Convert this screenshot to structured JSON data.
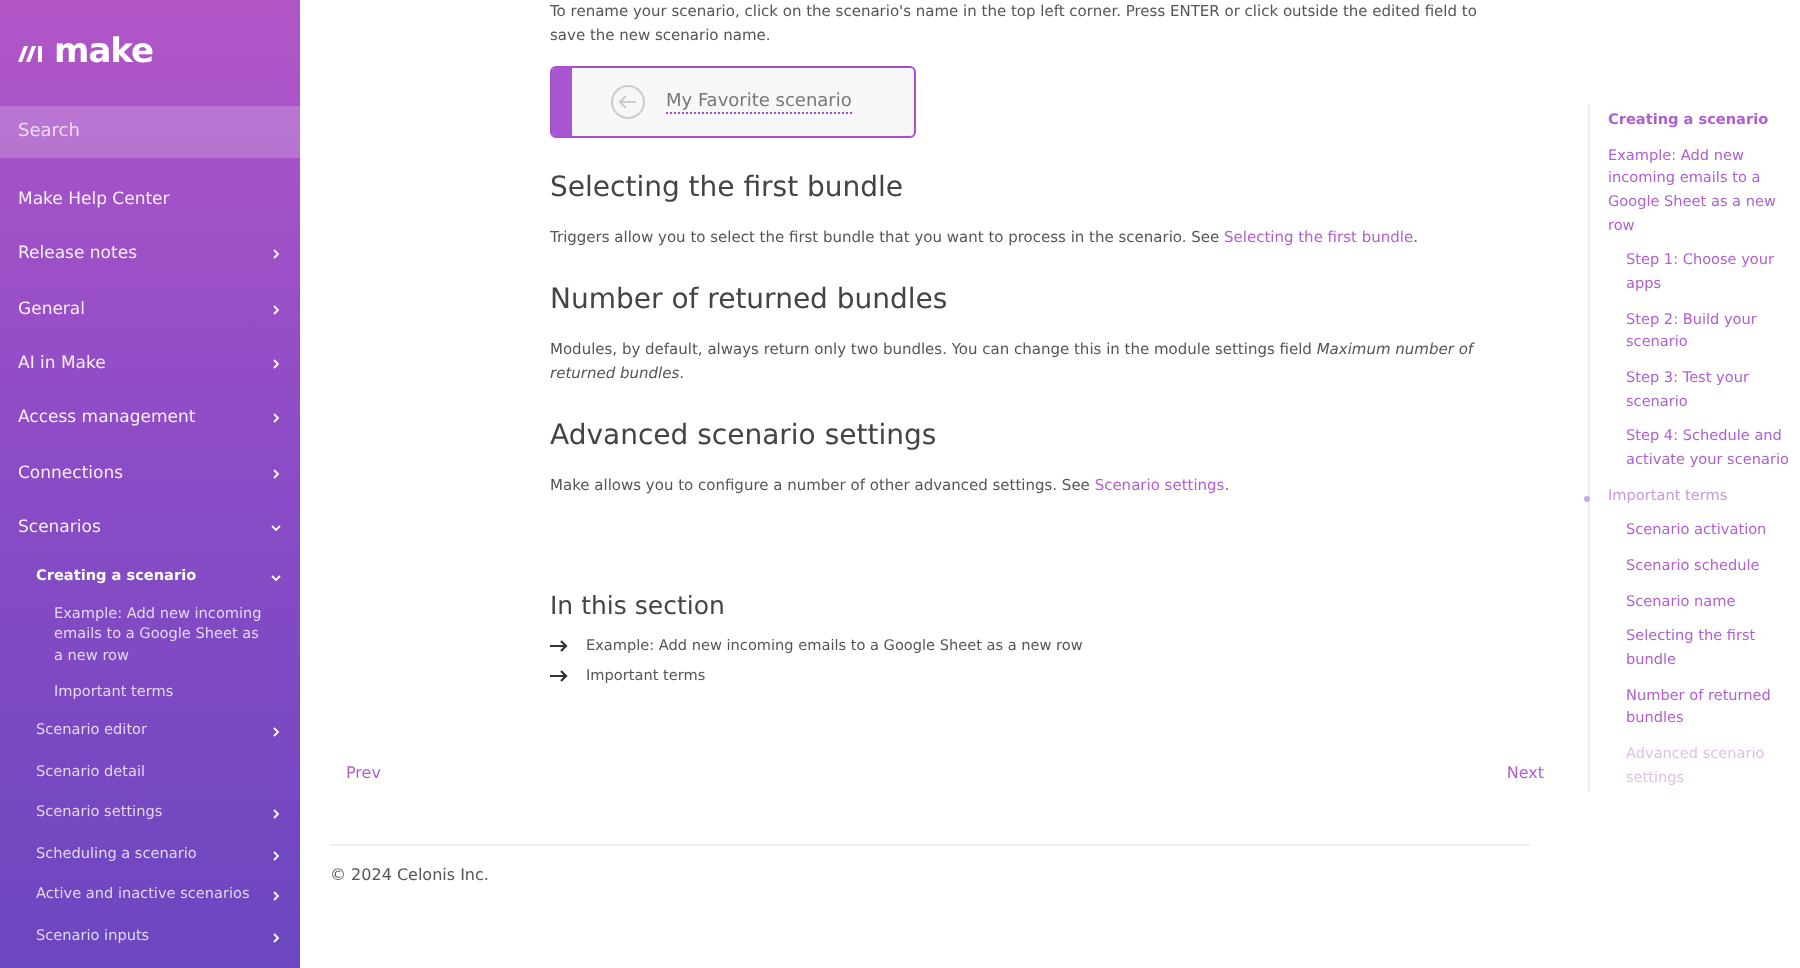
{
  "logo": "make",
  "search": {
    "placeholder": "Search"
  },
  "sidebar": {
    "items": [
      {
        "label": "Make Help Center"
      },
      {
        "label": "Release notes",
        "expanded": false
      },
      {
        "label": "General",
        "expanded": false
      },
      {
        "label": "AI in Make",
        "expanded": false
      },
      {
        "label": "Access management",
        "expanded": false
      },
      {
        "label": "Connections",
        "expanded": false
      },
      {
        "label": "Scenarios",
        "expanded": true,
        "children": [
          {
            "label": "Creating a scenario",
            "expanded": true,
            "selected": true,
            "children": [
              {
                "label": "Example: Add new incoming emails to a Google Sheet as a new row",
                "selected": false
              },
              {
                "label": "Important terms",
                "selected": false
              }
            ]
          },
          {
            "label": "Scenario editor",
            "expanded": false,
            "selected": false
          },
          {
            "label": "Scenario detail",
            "selected": false
          },
          {
            "label": "Scenario settings",
            "expanded": false,
            "selected": false
          },
          {
            "label": "Scheduling a scenario",
            "expanded": false,
            "selected": false
          },
          {
            "label": "Active and inactive scenarios",
            "expanded": false,
            "selected": false
          },
          {
            "label": "Scenario inputs",
            "expanded": false,
            "selected": false
          }
        ]
      }
    ]
  },
  "content": {
    "intro": "To rename your scenario, click on the scenario's name in the top left corner. Press ENTER or click outside the edited field to save the new scenario name.",
    "example_field": {
      "value": "My Favorite scenario"
    },
    "sections": [
      {
        "heading": "Selecting the first bundle",
        "text": "Triggers allow you to select the first bundle that you want to process in the scenario. See ",
        "link": "Selecting the first bundle",
        "after": "."
      },
      {
        "heading": "Number of returned bundles",
        "text": "Modules, by default, always return only two bundles. You can change this in the module settings field *Maximum number of returned bundles*."
      },
      {
        "heading": "Advanced scenario settings",
        "text": "Make allows you to configure a number of other advanced settings. See ",
        "link": "Scenario settings",
        "after": "."
      }
    ],
    "in_this_section": {
      "title": "In this section",
      "links": [
        "Example: Add new incoming emails to a Google Sheet as a new row",
        "Important terms"
      ]
    },
    "prev": "Prev",
    "next": "Next",
    "footer": "© 2024 Celonis Inc."
  },
  "toc": {
    "items": [
      {
        "label": "Creating a scenario",
        "selected": false,
        "faded": false,
        "children": [
          {
            "label": "Example: Add new incoming emails to a Google Sheet as a new row",
            "selected": false,
            "faded": false,
            "children": [
              {
                "label": "Step 1: Choose your apps",
                "selected": false,
                "faded": false
              },
              {
                "label": "Step 2: Build your scenario",
                "selected": false,
                "faded": false
              },
              {
                "label": "Step 3: Test your scenario",
                "selected": false,
                "faded": false
              },
              {
                "label": "Step 4: Schedule and activate your scenario",
                "selected": false,
                "faded": false
              }
            ]
          },
          {
            "label": "Important terms",
            "selected": true,
            "faded": false,
            "children": [
              {
                "label": "Scenario activation",
                "selected": false,
                "faded": false
              },
              {
                "label": "Scenario schedule",
                "selected": false,
                "faded": false
              },
              {
                "label": "Scenario name",
                "selected": false,
                "faded": false
              },
              {
                "label": "Selecting the first bundle",
                "selected": false,
                "faded": false
              },
              {
                "label": "Number of returned bundles",
                "selected": false,
                "faded": false
              },
              {
                "label": "Advanced scenario settings",
                "selected": false,
                "faded": true
              }
            ]
          }
        ]
      }
    ]
  }
}
